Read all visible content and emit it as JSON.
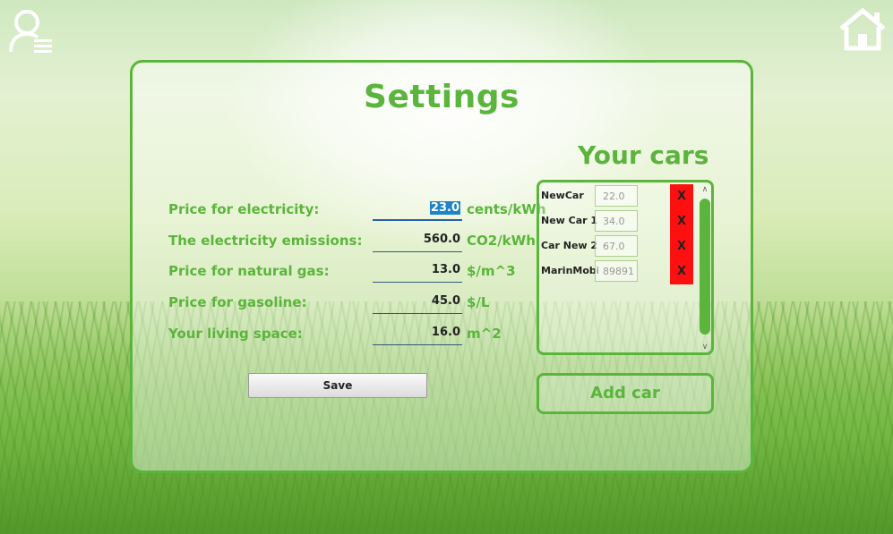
{
  "header": {
    "user_icon": "user-list-icon",
    "home_icon": "home-icon"
  },
  "settings": {
    "title": "Settings",
    "fields": [
      {
        "label": "Price for electricity:",
        "value": "23.0",
        "unit": "cents/kWh"
      },
      {
        "label": "The electricity emissions:",
        "value": "560.0",
        "unit": "CO2/kWh"
      },
      {
        "label": "Price for natural gas:",
        "value": "13.0",
        "unit": "$/m^3"
      },
      {
        "label": "Price for gasoline:",
        "value": "45.0",
        "unit": "$/L"
      },
      {
        "label": "Your living space:",
        "value": "16.0",
        "unit": "m^2"
      }
    ],
    "save_label": "Save"
  },
  "cars": {
    "title": "Your cars",
    "items": [
      {
        "name": "NewCar",
        "value": "22.0",
        "delete": "X"
      },
      {
        "name": "New Car 1",
        "value": "34.0",
        "delete": "X"
      },
      {
        "name": "Car New 2",
        "value": "67.0",
        "delete": "X"
      },
      {
        "name": "MarinMobile",
        "value": "89891",
        "delete": "X"
      }
    ],
    "add_label": "Add car"
  },
  "colors": {
    "accent": "#5bb53c",
    "delete": "#ff1010",
    "selection": "#1f83c8"
  }
}
